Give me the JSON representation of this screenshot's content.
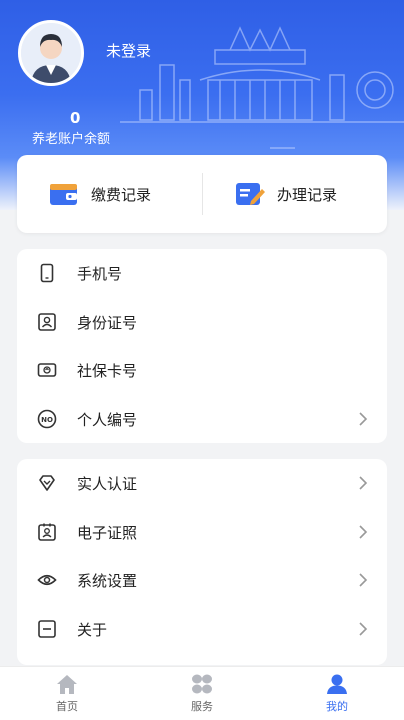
{
  "profile": {
    "login_status": "未登录",
    "balance_value": "0",
    "balance_label": "养老账户余额"
  },
  "records": {
    "payment_label": "缴费记录",
    "handling_label": "办理记录"
  },
  "info_list": [
    {
      "label": "手机号",
      "icon": "phone-icon",
      "has_arrow": false
    },
    {
      "label": "身份证号",
      "icon": "id-card-icon",
      "has_arrow": false
    },
    {
      "label": "社保卡号",
      "icon": "social-security-card-icon",
      "has_arrow": false
    },
    {
      "label": "个人编号",
      "icon": "number-badge-icon",
      "has_arrow": true
    }
  ],
  "settings_list": [
    {
      "label": "实人认证",
      "icon": "verify-diamond-icon",
      "has_arrow": true
    },
    {
      "label": "电子证照",
      "icon": "e-license-icon",
      "has_arrow": true
    },
    {
      "label": "系统设置",
      "icon": "eye-settings-icon",
      "has_arrow": true
    },
    {
      "label": "关于",
      "icon": "about-icon",
      "has_arrow": true
    }
  ],
  "tabbar": [
    {
      "label": "首页",
      "icon": "home-icon",
      "active": false
    },
    {
      "label": "服务",
      "icon": "service-grid-icon",
      "active": false
    },
    {
      "label": "我的",
      "icon": "profile-icon",
      "active": true
    }
  ],
  "colors": {
    "header_blue": "#3b6ef0",
    "accent": "#3a6ff0",
    "background": "#f2f3f5"
  }
}
